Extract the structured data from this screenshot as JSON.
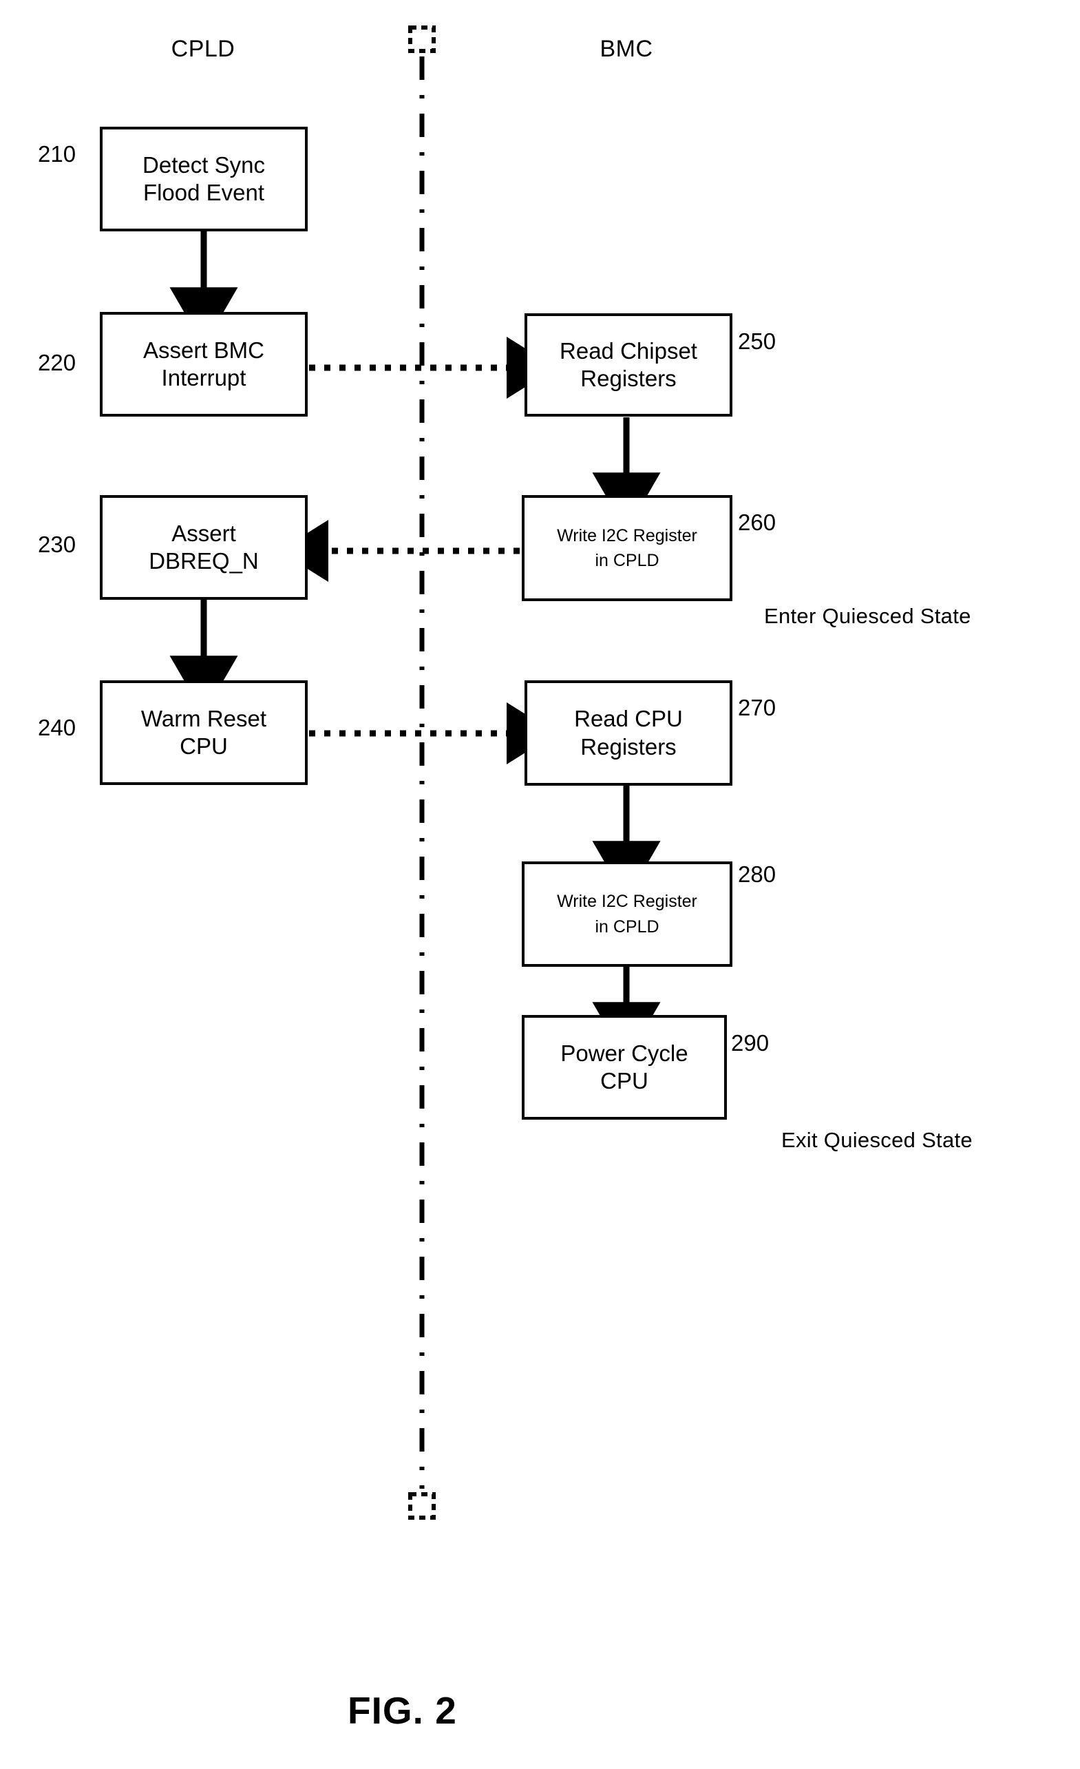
{
  "figure": {
    "caption": "FIG. 2"
  },
  "columns": [
    {
      "id": "cpld",
      "label": "CPLD"
    },
    {
      "id": "bmc",
      "label": "BMC"
    }
  ],
  "boxes": {
    "b210": {
      "ref": "210",
      "line1": "Detect Sync",
      "line2": "Flood Event"
    },
    "b220": {
      "ref": "220",
      "line1": "Assert BMC",
      "line2": "Interrupt"
    },
    "b230": {
      "ref": "230",
      "line1": "Assert",
      "line2": "DBREQ_N"
    },
    "b240": {
      "ref": "240",
      "line1": "Warm Reset",
      "line2": "CPU"
    },
    "b250": {
      "ref": "250",
      "line1": "Read Chipset",
      "line2": "Registers"
    },
    "b260": {
      "ref": "260",
      "line1": "Write I2C Register",
      "line2": "in CPLD"
    },
    "b270": {
      "ref": "270",
      "line1": "Read CPU",
      "line2": "Registers"
    },
    "b280": {
      "ref": "280",
      "line1": "Write I2C Register",
      "line2": "in CPLD"
    },
    "b290": {
      "ref": "290",
      "line1": "Power Cycle",
      "line2": "CPU"
    }
  },
  "notes": {
    "enter_quiesced": "Enter Quiesced State",
    "exit_quiesced": "Exit Quiesced State"
  },
  "colors": {
    "stroke": "#000000",
    "background": "#ffffff"
  }
}
